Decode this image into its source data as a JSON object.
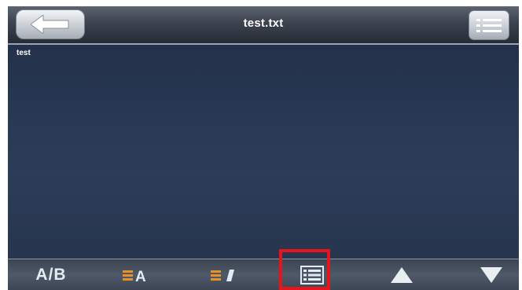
{
  "header": {
    "title": "test.txt",
    "back_icon": "back-arrow-icon",
    "menu_icon": "list-menu-icon"
  },
  "document": {
    "text": "test"
  },
  "toolbar": {
    "ab_label": "A/B",
    "font_size_label": "A",
    "buttons": [
      "ab-toggle",
      "font-size",
      "font-style",
      "page-list",
      "page-up",
      "page-down"
    ]
  },
  "colors": {
    "highlight": "#e8141c",
    "accent_orange": "#e8902a"
  }
}
